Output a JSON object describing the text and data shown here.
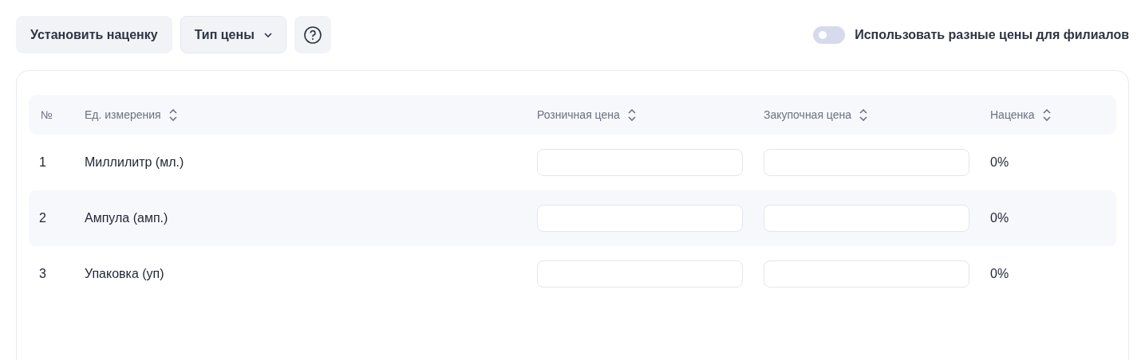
{
  "toolbar": {
    "markup_button": "Установить наценку",
    "price_type_button": "Тип цены",
    "branch_prices_toggle": {
      "label": "Использовать разные цены для филиалов",
      "on": false
    }
  },
  "table": {
    "columns": [
      {
        "label": "№",
        "sortable": false
      },
      {
        "label": "Ед. измерения",
        "sortable": true
      },
      {
        "label": "Розничная цена",
        "sortable": true
      },
      {
        "label": "Закупочная цена",
        "sortable": true
      },
      {
        "label": "Наценка",
        "sortable": true
      }
    ],
    "rows": [
      {
        "number": "1",
        "unit": "Миллилитр (мл.)",
        "markup": "0%"
      },
      {
        "number": "2",
        "unit": "Ампула (амп.)",
        "markup": "0%"
      },
      {
        "number": "3",
        "unit": "Упаковка (уп)",
        "markup": "0%"
      }
    ]
  }
}
